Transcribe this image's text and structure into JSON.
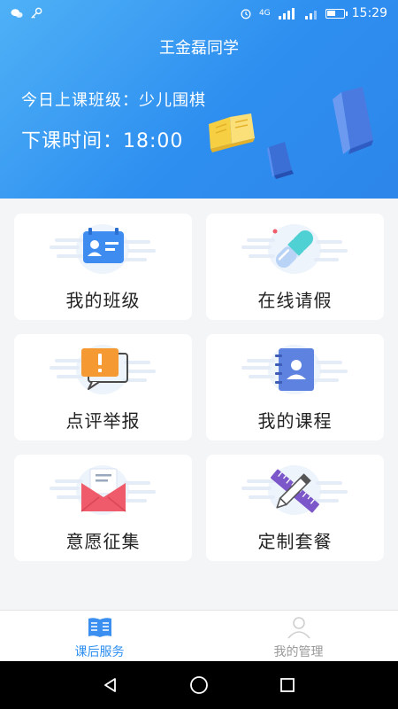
{
  "status_bar": {
    "time": "15:29",
    "network": "4G",
    "battery_level": 0.5
  },
  "header": {
    "title": "王金磊同学",
    "class_text": "今日上课班级：少儿围棋",
    "time_text": "下课时间：18:00"
  },
  "menu": {
    "items": [
      {
        "label": "我的班级",
        "icon": "id-card-icon"
      },
      {
        "label": "在线请假",
        "icon": "pill-icon"
      },
      {
        "label": "点评举报",
        "icon": "alert-message-icon"
      },
      {
        "label": "我的课程",
        "icon": "contact-book-icon"
      },
      {
        "label": "意愿征集",
        "icon": "envelope-icon"
      },
      {
        "label": "定制套餐",
        "icon": "ruler-pencil-icon"
      }
    ]
  },
  "bottom_nav": {
    "items": [
      {
        "label": "课后服务",
        "icon": "book-icon",
        "active": true
      },
      {
        "label": "我的管理",
        "icon": "person-icon",
        "active": false
      }
    ]
  },
  "colors": {
    "primary": "#2e8ff0",
    "header_start": "#4fb1f6",
    "card_bg": "#ffffff",
    "page_bg": "#f4f5f7"
  }
}
